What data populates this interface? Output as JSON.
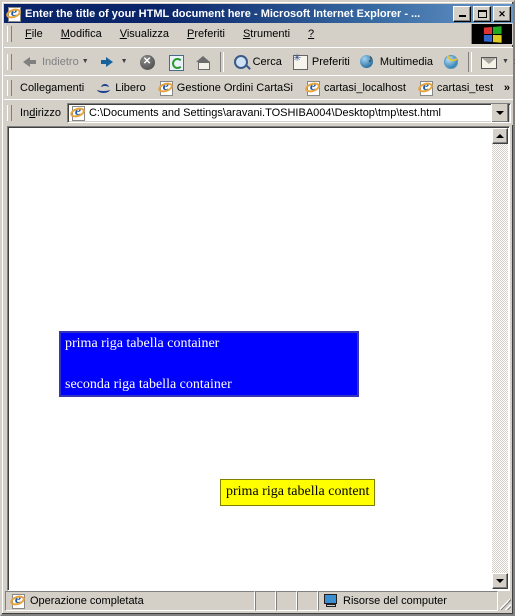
{
  "window": {
    "title": "Enter the title of your HTML document here - Microsoft Internet Explorer - ...",
    "app_icon": "ie-document-icon",
    "buttons": {
      "minimize": "_",
      "maximize": "□",
      "close": "✕"
    }
  },
  "menu": {
    "items": [
      {
        "label": "File",
        "accel": "F"
      },
      {
        "label": "Modifica",
        "accel": "M"
      },
      {
        "label": "Visualizza",
        "accel": "V"
      },
      {
        "label": "Preferiti",
        "accel": "P"
      },
      {
        "label": "Strumenti",
        "accel": "S"
      },
      {
        "label": "?",
        "accel": "?"
      }
    ],
    "logo": "windows-flag-logo"
  },
  "toolbar": {
    "back": {
      "label": "Indietro",
      "icon": "arrow-left-icon",
      "disabled": true
    },
    "forward": {
      "label": "",
      "icon": "arrow-right-icon"
    },
    "stop": {
      "label": "",
      "icon": "stop-icon"
    },
    "refresh": {
      "label": "",
      "icon": "refresh-icon"
    },
    "home": {
      "label": "",
      "icon": "home-icon"
    },
    "search": {
      "label": "Cerca",
      "icon": "search-icon"
    },
    "favorites": {
      "label": "Preferiti",
      "icon": "favorites-star-icon"
    },
    "media": {
      "label": "Multimedia",
      "icon": "media-icon"
    },
    "history": {
      "label": "",
      "icon": "history-icon"
    },
    "mail": {
      "label": "",
      "icon": "mail-icon"
    },
    "overflow": "»"
  },
  "links_bar": {
    "label": "Collegamenti",
    "items": [
      {
        "label": "Libero",
        "icon": "libero-icon"
      },
      {
        "label": "Gestione Ordini CartaSi",
        "icon": "ie-document-icon"
      },
      {
        "label": "cartasi_localhost",
        "icon": "ie-document-icon"
      },
      {
        "label": "cartasi_test",
        "icon": "ie-document-icon"
      }
    ],
    "overflow": "»"
  },
  "address_bar": {
    "label": "Indirizzo",
    "icon": "ie-document-icon",
    "value": "C:\\Documents and Settings\\aravani.TOSHIBA004\\Desktop\\tmp\\test.html",
    "placeholder": "",
    "dropdown": "chevron-down-icon"
  },
  "page": {
    "container_table": {
      "background": "#0000ff",
      "text_color": "#ffffff",
      "rows": [
        "prima riga tabella container",
        "seconda riga tabella container"
      ]
    },
    "content_table": {
      "background": "#ffff00",
      "border_color": "#808000",
      "text_color": "#000000",
      "rows": [
        "prima riga tabella content"
      ]
    }
  },
  "scrollbar": {
    "up": "scroll-up-arrow",
    "down": "scroll-down-arrow"
  },
  "status_bar": {
    "message": "Operazione completata",
    "icon": "ie-document-icon",
    "zone": "Risorse del computer",
    "zone_icon": "computer-icon"
  }
}
